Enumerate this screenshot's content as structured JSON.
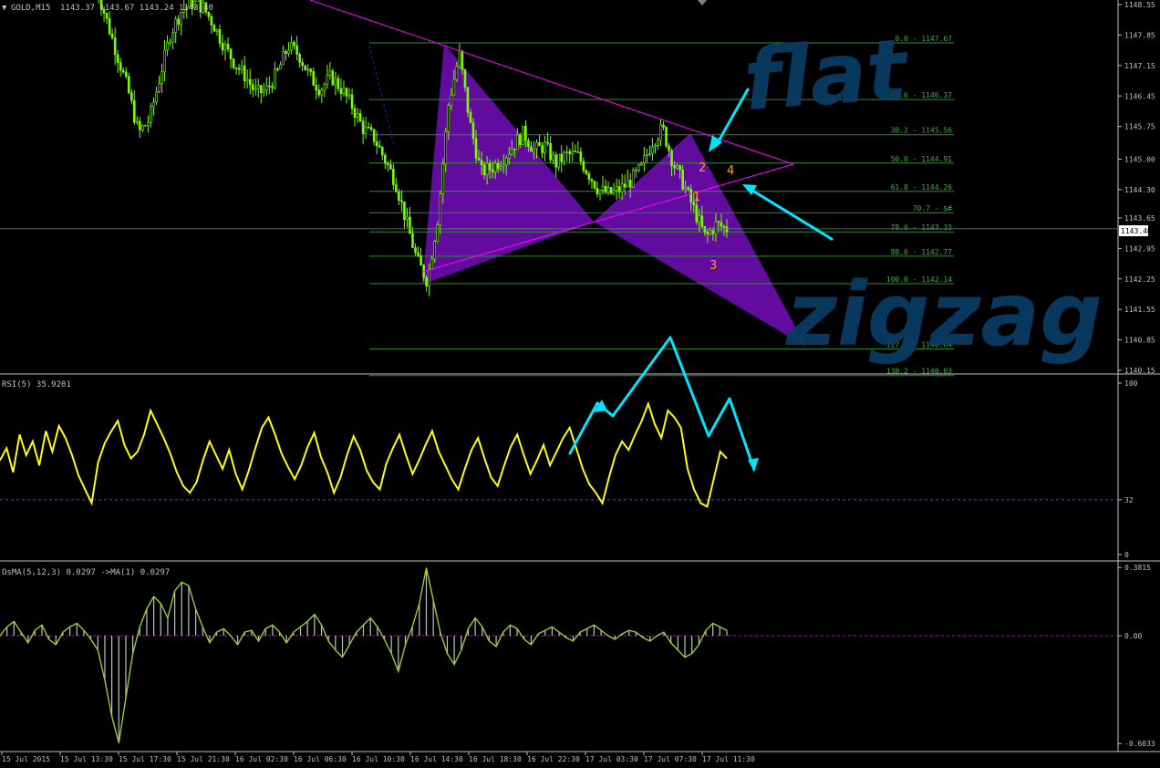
{
  "window": {
    "symbol_label": "GOLD,M15",
    "ohlc": "1143.37 1143.67 1143.24 1143.40"
  },
  "colors": {
    "background": "#000000",
    "axis": "#c0c0c0",
    "bull_candle": "#7CFC00",
    "fib": "#2e8b2e",
    "fib_text": "#3fae3f",
    "triangle": "#ff00ff",
    "harmonic_fill": "#6a0dad",
    "rsi": "#ffff00",
    "osma": "#9acd32",
    "annotation": "#00e5ff",
    "handwriting": "#0a3c64",
    "wave_labels": "#ffa500"
  },
  "price_axis": {
    "ticks": [
      "1148.55",
      "1147.85",
      "1147.15",
      "1146.45",
      "1145.75",
      "1145.00",
      "1144.30",
      "1143.65",
      "1142.95",
      "1142.25",
      "1141.55",
      "1140.85",
      "1140.15"
    ],
    "current_price": "1143.40"
  },
  "fib_levels": [
    {
      "label": "0.0 - 1147.67"
    },
    {
      "label": "23.6 - 1146.37"
    },
    {
      "label": "38.2 - 1145.56"
    },
    {
      "label": "50.0 - 1144.91"
    },
    {
      "label": "61.8 - 1144.26"
    },
    {
      "label": "70.7 - $#"
    },
    {
      "label": "78.6 - 1143.33"
    },
    {
      "label": "88.6 - 1142.77"
    },
    {
      "label": "100.0 - 1142.14"
    },
    {
      "label": "127.2 - 1140.64"
    },
    {
      "label": "138.2 - 1140.03"
    }
  ],
  "wave_labels": [
    "1",
    "2",
    "3",
    "4"
  ],
  "handwriting": {
    "word1": "flat",
    "word2": "zigzag"
  },
  "rsi": {
    "label": "RSI(5) 35.9201",
    "axis_ticks": [
      "100",
      "32",
      "0"
    ],
    "level_value": 32
  },
  "osma": {
    "label": "OsMA(5,12,3) 0.0297  ->MA(1) 0.0297",
    "axis_ticks": [
      "0.3815",
      "0.00",
      "-0.6033"
    ]
  },
  "time_axis": {
    "labels": [
      "15 Jul 2015",
      "15 Jul 13:30",
      "15 Jul 17:30",
      "15 Jul 21:30",
      "16 Jul 02:30",
      "16 Jul 06:30",
      "16 Jul 10:30",
      "16 Jul 14:30",
      "16 Jul 18:30",
      "16 Jul 22:30",
      "17 Jul 03:30",
      "17 Jul 07:30",
      "17 Jul 11:30"
    ]
  },
  "chart_data": {
    "type": "candlestick",
    "symbol": "GOLD",
    "timeframe": "M15",
    "ylim": [
      1140.0,
      1148.6
    ],
    "close_path": [
      1149.0,
      1148.2,
      1147.4,
      1146.6,
      1145.6,
      1145.9,
      1146.9,
      1147.9,
      1148.4,
      1148.6,
      1148.5,
      1148.1,
      1147.6,
      1147.2,
      1146.9,
      1146.5,
      1146.6,
      1147.0,
      1147.6,
      1147.4,
      1146.9,
      1146.6,
      1146.9,
      1146.6,
      1146.2,
      1145.7,
      1145.5,
      1145.0,
      1144.5,
      1143.6,
      1142.7,
      1142.2,
      1143.7,
      1146.3,
      1147.4,
      1145.8,
      1144.7,
      1144.8,
      1145.0,
      1145.3,
      1145.6,
      1145.2,
      1145.3,
      1144.9,
      1145.1,
      1145.1,
      1144.7,
      1144.3,
      1144.2,
      1144.3,
      1144.5,
      1144.8,
      1145.4,
      1145.7,
      1144.9,
      1144.4,
      1143.8,
      1143.2,
      1143.5,
      1143.4
    ],
    "rsi_level": 32,
    "rsi_series": [
      55,
      62,
      48,
      70,
      58,
      66,
      52,
      72,
      60,
      75,
      68,
      58,
      46,
      38,
      30,
      54,
      65,
      72,
      78,
      64,
      56,
      60,
      70,
      84,
      76,
      68,
      59,
      48,
      40,
      36,
      42,
      55,
      66,
      58,
      50,
      61,
      47,
      38,
      49,
      62,
      74,
      80,
      70,
      59,
      51,
      44,
      52,
      63,
      71,
      57,
      48,
      36,
      45,
      58,
      69,
      61,
      49,
      42,
      38,
      53,
      62,
      70,
      58,
      47,
      55,
      64,
      72,
      60,
      52,
      44,
      38,
      50,
      61,
      68,
      56,
      45,
      40,
      52,
      63,
      70,
      58,
      47,
      55,
      64,
      52,
      60,
      68,
      74,
      62,
      50,
      41,
      36,
      30,
      45,
      58,
      66,
      61,
      70,
      78,
      88,
      76,
      68,
      84,
      80,
      74,
      50,
      38,
      30,
      28,
      44,
      60,
      56
    ],
    "osma_series": [
      0.0,
      0.05,
      0.08,
      0.02,
      -0.04,
      0.03,
      0.06,
      -0.02,
      -0.05,
      0.02,
      0.05,
      0.07,
      0.03,
      -0.02,
      -0.08,
      -0.25,
      -0.45,
      -0.6,
      -0.35,
      -0.1,
      0.05,
      0.15,
      0.22,
      0.18,
      0.1,
      0.25,
      0.3,
      0.28,
      0.15,
      0.05,
      -0.04,
      0.02,
      0.04,
      0.0,
      -0.05,
      0.02,
      0.03,
      -0.03,
      0.04,
      0.06,
      0.02,
      -0.04,
      0.02,
      0.05,
      0.08,
      0.12,
      0.06,
      -0.03,
      -0.08,
      -0.12,
      -0.05,
      0.02,
      0.06,
      0.1,
      0.05,
      -0.02,
      -0.1,
      -0.2,
      -0.05,
      0.05,
      0.18,
      0.38,
      0.2,
      0.02,
      -0.1,
      -0.16,
      -0.08,
      0.04,
      0.1,
      0.05,
      -0.03,
      -0.06,
      0.02,
      0.06,
      0.04,
      -0.02,
      -0.05,
      0.01,
      0.03,
      0.05,
      0.02,
      -0.01,
      -0.03,
      0.02,
      0.04,
      0.06,
      0.03,
      0.0,
      -0.02,
      0.01,
      0.03,
      0.02,
      -0.01,
      -0.03,
      0.0,
      0.02,
      -0.04,
      -0.08,
      -0.12,
      -0.1,
      -0.05,
      0.03,
      0.07,
      0.05,
      0.03
    ],
    "current_price": 1143.4
  }
}
